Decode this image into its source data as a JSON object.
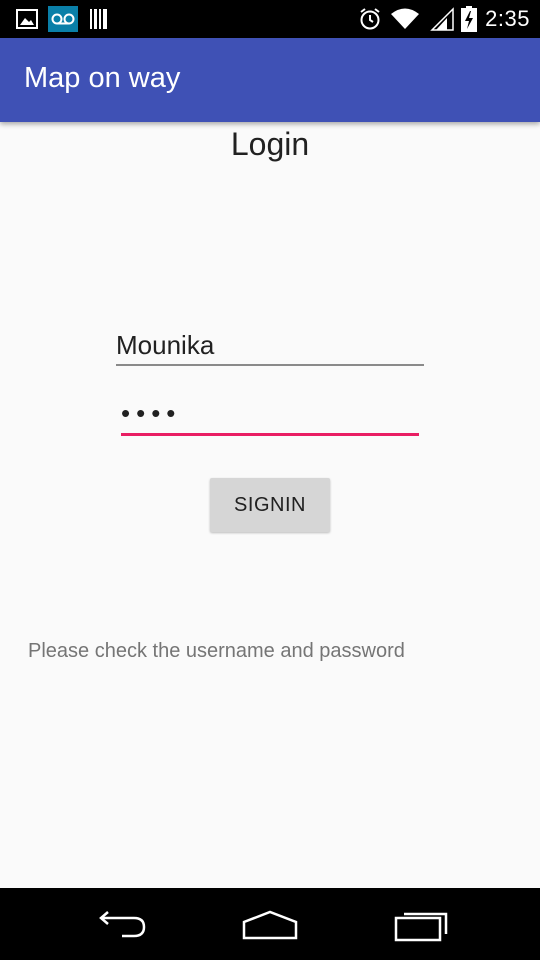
{
  "status_bar": {
    "time": "2:35",
    "icons": [
      "image-icon",
      "voicemail-icon",
      "barcode-icon",
      "alarm-icon",
      "wifi-icon",
      "signal-icon",
      "battery-charging-icon"
    ]
  },
  "app_bar": {
    "title": "Map on way",
    "color": "#3f51b5"
  },
  "login": {
    "heading": "Login",
    "username_value": "Mounika",
    "password_value": "••••",
    "signin_label": "SIGNIN",
    "message": "Please check the username and password",
    "accent_color": "#e91e63"
  },
  "nav_bar": {
    "buttons": [
      "back-icon",
      "home-icon",
      "recents-icon"
    ]
  }
}
